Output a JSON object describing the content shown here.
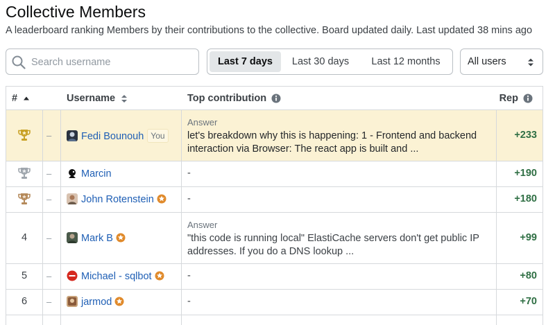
{
  "header": {
    "title": "Collective Members",
    "subtitle": "A leaderboard ranking Members by their contributions to the collective. Board updated daily. Last updated 38 mins ago"
  },
  "search": {
    "placeholder": "Search username",
    "icon": "search-icon"
  },
  "time_filters": [
    {
      "label": "Last 7 days",
      "active": true
    },
    {
      "label": "Last 30 days",
      "active": false
    },
    {
      "label": "Last 12 months",
      "active": false
    }
  ],
  "user_filter": {
    "selected": "All users"
  },
  "table": {
    "columns": {
      "rank": "#",
      "username": "Username",
      "contribution": "Top contribution",
      "rep": "Rep"
    },
    "rows": [
      {
        "rank": "",
        "trophy": "gold",
        "change": "–",
        "username": "Fedi Bounouh",
        "badge": "You",
        "staff": false,
        "contribution_label": "Answer",
        "contribution": "let's breakdown why this is happening: 1 - Frontend and backend interaction via Browser: The react app is built and ...",
        "rep": "+233",
        "highlight": true
      },
      {
        "rank": "",
        "trophy": "silver",
        "change": "–",
        "username": "Marcin",
        "badge": "",
        "staff": false,
        "contribution_label": "",
        "contribution": "-",
        "rep": "+190",
        "highlight": false
      },
      {
        "rank": "",
        "trophy": "bronze",
        "change": "–",
        "username": "John Rotenstein",
        "badge": "",
        "staff": true,
        "contribution_label": "",
        "contribution": "-",
        "rep": "+180",
        "highlight": false
      },
      {
        "rank": "4",
        "trophy": "",
        "change": "–",
        "username": "Mark B",
        "badge": "",
        "staff": true,
        "contribution_label": "Answer",
        "contribution": "\"this code is running local\" ElastiCache servers don't get public IP addresses. If you do a DNS lookup ...",
        "rep": "+99",
        "highlight": false
      },
      {
        "rank": "5",
        "trophy": "",
        "change": "–",
        "username": "Michael - sqlbot",
        "badge": "",
        "staff": true,
        "contribution_label": "",
        "contribution": "-",
        "rep": "+80",
        "highlight": false
      },
      {
        "rank": "6",
        "trophy": "",
        "change": "–",
        "username": "jarmod",
        "badge": "",
        "staff": true,
        "contribution_label": "",
        "contribution": "-",
        "rep": "+70",
        "highlight": false
      }
    ]
  },
  "colors": {
    "link": "#1f5fb5",
    "rep": "#2f6f44",
    "highlight_row": "#fbf2d4",
    "staff_badge": "#e08a2b",
    "gold": "#c9a227",
    "silver": "#9fa6ad",
    "bronze": "#b58a5b"
  }
}
